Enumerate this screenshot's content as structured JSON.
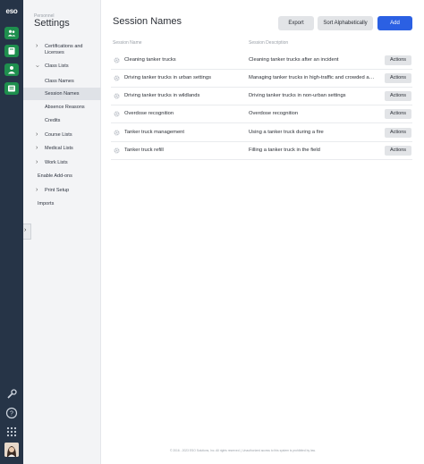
{
  "rail": {
    "logo": "eso",
    "colors": {
      "bg": "#263447",
      "app_accent": "#1e8f4e"
    }
  },
  "sidebar": {
    "subtitle": "Personnel",
    "title": "Settings",
    "items": [
      {
        "label": "Certifications and Licenses",
        "chevron": ">"
      },
      {
        "label": "Class Lists",
        "chevron": "v"
      },
      {
        "label": "Class Names"
      },
      {
        "label": "Session Names"
      },
      {
        "label": "Absence Reasons"
      },
      {
        "label": "Credits"
      },
      {
        "label": "Course Lists",
        "chevron": ">"
      },
      {
        "label": "Medical Lists",
        "chevron": ">"
      },
      {
        "label": "Work Lists",
        "chevron": ">"
      },
      {
        "label": "Enable Add-ons"
      },
      {
        "label": "Print Setup",
        "chevron": ">"
      },
      {
        "label": "Imports"
      }
    ]
  },
  "main": {
    "title": "Session Names",
    "buttons": {
      "export": "Export",
      "sort": "Sort Alphabetically",
      "add": "Add"
    },
    "columns": {
      "name": "Session Name",
      "description": "Session Description"
    },
    "rows": [
      {
        "name": "Cleaning tanker trucks",
        "description": "Cleaning tanker trucks after an incident",
        "action": "Actions"
      },
      {
        "name": "Driving tanker trucks in urban settings",
        "description": "Managing tanker trucks in high-traffic and crowded areas",
        "action": "Actions"
      },
      {
        "name": "Driving tanker trucks in wildlands",
        "description": "Driving tanker trucks in non-urban settings",
        "action": "Actions"
      },
      {
        "name": "Overdose recognition",
        "description": "Overdose recognition",
        "action": "Actions"
      },
      {
        "name": "Tanker truck management",
        "description": "Using a tanker truck during a fire",
        "action": "Actions"
      },
      {
        "name": "Tanker truck refill",
        "description": "Filling a tanker truck in the field",
        "action": "Actions"
      }
    ],
    "footer": "© 2016 - 2023 ESO Solutions, Inc. All rights reserved. | Unauthorized access to this system is prohibited by law.",
    "accent": "#2b60e3"
  }
}
